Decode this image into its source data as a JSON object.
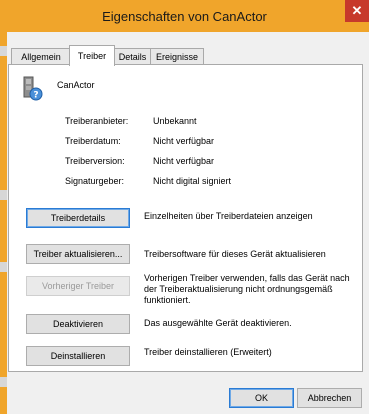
{
  "window": {
    "title": "Eigenschaften von CanActor",
    "close_glyph": "✕"
  },
  "tabs": [
    {
      "label": "Allgemein",
      "active": false
    },
    {
      "label": "Treiber",
      "active": true
    },
    {
      "label": "Details",
      "active": false
    },
    {
      "label": "Ereignisse",
      "active": false
    }
  ],
  "device": {
    "name": "CanActor",
    "icon": "unknown-device-icon"
  },
  "info": {
    "provider_label": "Treiberanbieter:",
    "provider_value": "Unbekannt",
    "date_label": "Treiberdatum:",
    "date_value": "Nicht verfügbar",
    "version_label": "Treiberversion:",
    "version_value": "Nicht verfügbar",
    "signer_label": "Signaturgeber:",
    "signer_value": "Nicht digital signiert"
  },
  "actions": {
    "details": {
      "label": "Treiberdetails",
      "desc": "Einzelheiten über Treiberdateien anzeigen"
    },
    "update": {
      "label": "Treiber aktualisieren...",
      "desc": "Treibersoftware für dieses Gerät aktualisieren"
    },
    "rollback": {
      "label": "Vorheriger Treiber",
      "desc": "Vorherigen Treiber verwenden, falls das Gerät nach der Treiberaktualisierung nicht ordnungsgemäß funktioniert."
    },
    "disable": {
      "label": "Deaktivieren",
      "desc": "Das ausgewählte Gerät deaktivieren."
    },
    "uninstall": {
      "label": "Deinstallieren",
      "desc": "Treiber deinstallieren (Erweitert)"
    }
  },
  "footer": {
    "ok": "OK",
    "cancel": "Abbrechen"
  },
  "colors": {
    "frame": "#f0a52b",
    "close": "#c7392b",
    "client": "#f0f0f0",
    "focus": "#2a7bd4"
  }
}
